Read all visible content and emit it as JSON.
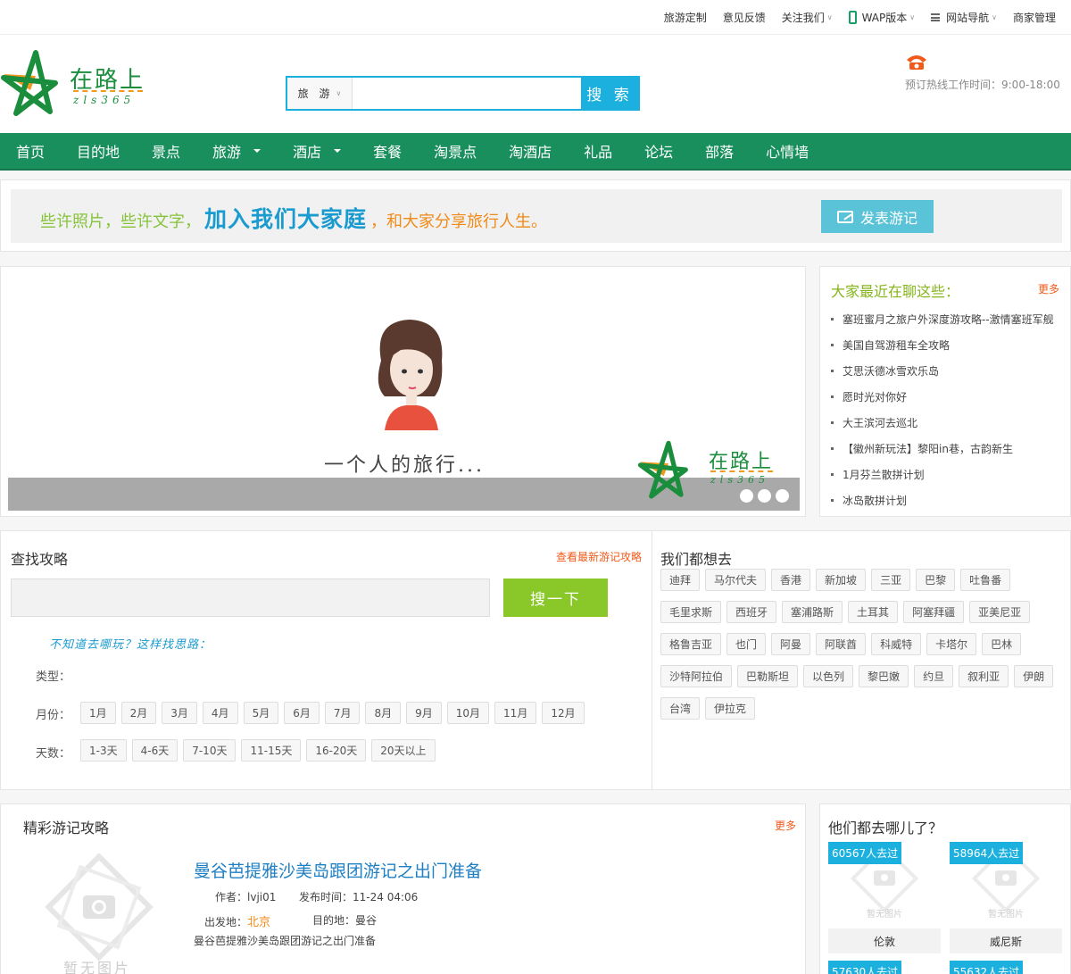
{
  "topbar": {
    "links": [
      {
        "label": "旅游定制",
        "caret": false
      },
      {
        "label": "意见反馈",
        "caret": false
      },
      {
        "label": "关注我们",
        "caret": true
      },
      {
        "label": "WAP版本",
        "caret": true,
        "icon": "mobile-phone-icon"
      },
      {
        "label": "网站导航",
        "caret": true,
        "icon": "menu-icon"
      },
      {
        "label": "商家管理",
        "caret": false
      }
    ]
  },
  "logo": {
    "text": "在路上",
    "sub": "zls365"
  },
  "search": {
    "category": "旅 游",
    "placeholder": "",
    "value": "",
    "button": "搜 索"
  },
  "hotline": {
    "icon": "telephone-icon",
    "text": "预订热线工作时间：9:00-18:00"
  },
  "nav": {
    "items": [
      {
        "label": "首页",
        "dropdown": false
      },
      {
        "label": "目的地",
        "dropdown": false
      },
      {
        "label": "景点",
        "dropdown": false
      },
      {
        "label": "旅游",
        "dropdown": true
      },
      {
        "label": "酒店",
        "dropdown": true
      },
      {
        "label": "套餐",
        "dropdown": false
      },
      {
        "label": "淘景点",
        "dropdown": false
      },
      {
        "label": "淘酒店",
        "dropdown": false
      },
      {
        "label": "礼品",
        "dropdown": false
      },
      {
        "label": "论坛",
        "dropdown": false
      },
      {
        "label": "部落",
        "dropdown": false
      },
      {
        "label": "心情墙",
        "dropdown": false
      }
    ],
    "color": "#1a8f5e"
  },
  "banner": {
    "slogan_part1": "些许照片，些许文字，",
    "slogan_part2": "加入我们大家庭",
    "slogan_part3": "，和大家分享旅行人生。",
    "post_button": "发表游记"
  },
  "slider": {
    "caption": "一个人的旅行...",
    "logo_text": "在路上",
    "logo_sub": "zls365",
    "dots": 3
  },
  "chat": {
    "title": "大家最近在聊这些：",
    "more": "更多",
    "items": [
      "塞班蜜月之旅户外深度游攻略--激情塞班军舰",
      "美国自驾游租车全攻略",
      "艾思沃德冰雪欢乐岛",
      "愿时光对你好",
      "大王滨河去巡北",
      "【徽州新玩法】黎阳in巷，古韵新生",
      "1月芬兰散拼计划",
      "冰岛散拼计划"
    ]
  },
  "find": {
    "title": "查找攻略",
    "more": "查看最新游记攻略",
    "input_value": "",
    "button": "搜一下",
    "hint": "不知道去哪玩？这样找思路：",
    "type_label": "类型：",
    "month_label": "月份：",
    "months": [
      "1月",
      "2月",
      "3月",
      "4月",
      "5月",
      "6月",
      "7月",
      "8月",
      "9月",
      "10月",
      "11月",
      "12月"
    ],
    "days_label": "天数：",
    "days": [
      "1-3天",
      "4-6天",
      "7-10天",
      "11-15天",
      "16-20天",
      "20天以上"
    ]
  },
  "places": {
    "title": "我们都想去",
    "tags": [
      "迪拜",
      "马尔代夫",
      "香港",
      "新加坡",
      "三亚",
      "巴黎",
      "吐鲁番",
      "毛里求斯",
      "西班牙",
      "塞浦路斯",
      "土耳其",
      "阿塞拜疆",
      "亚美尼亚",
      "格鲁吉亚",
      "也门",
      "阿曼",
      "阿联酋",
      "科威特",
      "卡塔尔",
      "巴林",
      "沙特阿拉伯",
      "巴勒斯坦",
      "以色列",
      "黎巴嫩",
      "约旦",
      "叙利亚",
      "伊朗",
      "台湾",
      "伊拉克"
    ]
  },
  "articles": {
    "title": "精彩游记攻略",
    "more": "更多",
    "noimg_text": "暂无图片",
    "item": {
      "title": "曼谷芭提雅沙美岛跟团游记之出门准备",
      "author_label": "作者：",
      "author": "lvji01",
      "time_label": "发布时间：",
      "time": "11-24 04:06",
      "from_label": "出发地：",
      "from": "北京",
      "to_label": "目的地：",
      "to": "曼谷",
      "excerpt": "曼谷芭提雅沙美岛跟团游记之出门准备"
    }
  },
  "where": {
    "title": "他们都去哪儿了？",
    "noimg_text": "暂无图片",
    "cards": [
      {
        "badge": "60567人去过",
        "name": "伦敦"
      },
      {
        "badge": "58964人去过",
        "name": "威尼斯"
      },
      {
        "badge": "57630人去过",
        "name": ""
      },
      {
        "badge": "55632人去过",
        "name": ""
      }
    ]
  }
}
